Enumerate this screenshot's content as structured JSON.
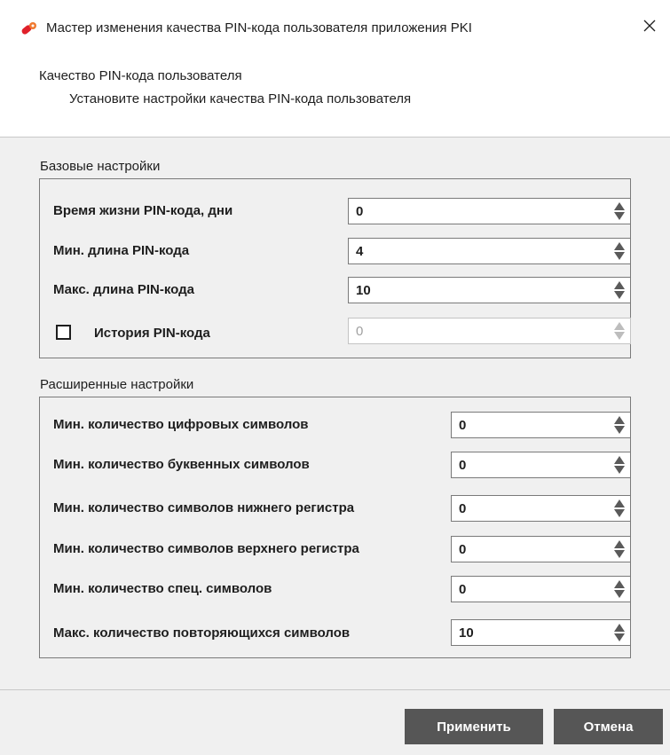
{
  "window": {
    "title": "Мастер изменения качества PIN-кода пользователя приложения PKI",
    "icon": "pki-key-icon",
    "close_icon": "close-icon"
  },
  "header": {
    "title": "Качество PIN-кода пользователя",
    "subtitle": "Установите настройки качества PIN-кода пользователя"
  },
  "basic": {
    "label": "Базовые настройки",
    "rows": [
      {
        "label": "Время жизни PIN-кода, дни",
        "value": "0"
      },
      {
        "label": "Мин. длина PIN-кода",
        "value": "4"
      },
      {
        "label": "Макс. длина PIN-кода",
        "value": "10"
      },
      {
        "label": "История PIN-кода",
        "value": "0",
        "checked": false,
        "enabled": false
      }
    ]
  },
  "advanced": {
    "label": "Расширенные настройки",
    "rows": [
      {
        "label": "Мин. количество цифровых символов",
        "value": "0"
      },
      {
        "label": "Мин. количество буквенных символов",
        "value": "0"
      },
      {
        "label": "Мин. количество символов нижнего регистра",
        "value": "0"
      },
      {
        "label": "Мин. количество символов верхнего регистра",
        "value": "0"
      },
      {
        "label": "Мин. количество спец. символов",
        "value": "0"
      },
      {
        "label": "Макс. количество повторяющихся символов",
        "value": "10"
      }
    ]
  },
  "buttons": {
    "apply": "Применить",
    "cancel": "Отмена"
  },
  "colors": {
    "button_bg": "#565656",
    "icon_accent": "#e0202a"
  }
}
